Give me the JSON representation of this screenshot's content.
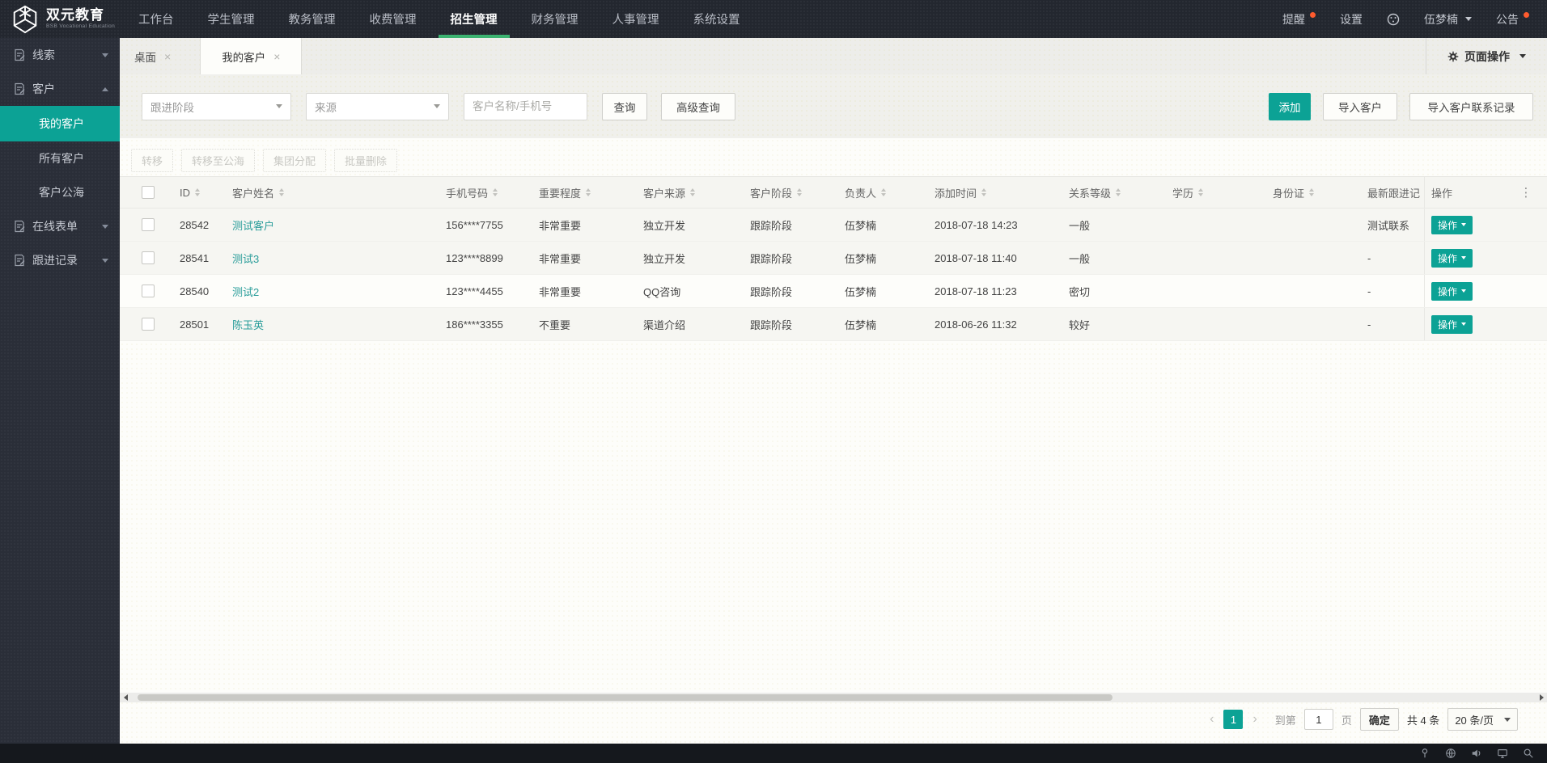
{
  "navbar": {
    "logo_title": "双元教育",
    "logo_subtitle": "BSB Vocational Education",
    "menu": [
      "工作台",
      "学生管理",
      "教务管理",
      "收费管理",
      "招生管理",
      "财务管理",
      "人事管理",
      "系统设置"
    ],
    "right": {
      "reminder": "提醒",
      "settings": "设置",
      "user": "伍梦楠",
      "announcement": "公告"
    }
  },
  "sidebar": {
    "leads": "线索",
    "customers": "客户",
    "my_customers": "我的客户",
    "all_customers": "所有客户",
    "customer_pool": "客户公海",
    "online_forms": "在线表单",
    "follow_records": "跟进记录"
  },
  "tabs": {
    "desktop": "桌面",
    "my_customers": "我的客户",
    "page_actions": "页面操作"
  },
  "filters": {
    "stage_placeholder": "跟进阶段",
    "source_placeholder": "来源",
    "keyword_placeholder": "客户名称/手机号",
    "search": "查询",
    "advanced": "高级查询",
    "add": "添加",
    "import_customers": "导入客户",
    "import_records": "导入客户联系记录"
  },
  "bulk": {
    "transfer": "转移",
    "transfer_pool": "转移至公海",
    "group_assign": "集团分配",
    "batch_delete": "批量删除"
  },
  "table": {
    "headers": [
      "ID",
      "客户姓名",
      "手机号码",
      "重要程度",
      "客户来源",
      "客户阶段",
      "负责人",
      "添加时间",
      "关系等级",
      "学历",
      "身份证",
      "最新跟进记",
      "操作"
    ],
    "action_label": "操作",
    "rows": [
      {
        "id": "28542",
        "name": "测试客户",
        "phone": "156****7755",
        "importance": "非常重要",
        "source": "独立开发",
        "stage": "跟踪阶段",
        "owner": "伍梦楠",
        "added": "2018-07-18 14:23",
        "relation": "一般",
        "education": "",
        "id_card": "",
        "latest": "测试联系"
      },
      {
        "id": "28541",
        "name": "测试3",
        "phone": "123****8899",
        "importance": "非常重要",
        "source": "独立开发",
        "stage": "跟踪阶段",
        "owner": "伍梦楠",
        "added": "2018-07-18 11:40",
        "relation": "一般",
        "education": "",
        "id_card": "",
        "latest": "-"
      },
      {
        "id": "28540",
        "name": "测试2",
        "phone": "123****4455",
        "importance": "非常重要",
        "source": "QQ咨询",
        "stage": "跟踪阶段",
        "owner": "伍梦楠",
        "added": "2018-07-18 11:23",
        "relation": "密切",
        "education": "",
        "id_card": "",
        "latest": "-"
      },
      {
        "id": "28501",
        "name": "陈玉英",
        "phone": "186****3355",
        "importance": "不重要",
        "source": "渠道介绍",
        "stage": "跟踪阶段",
        "owner": "伍梦楠",
        "added": "2018-06-26 11:32",
        "relation": "较好",
        "education": "",
        "id_card": "",
        "latest": "-"
      }
    ]
  },
  "pagination": {
    "page_current": "1",
    "goto_label": "到第",
    "page_input": "1",
    "page_unit": "页",
    "confirm_label": "确定",
    "total_label": "共 4 条",
    "page_size": "20 条/页"
  },
  "icons": {
    "close": "×",
    "dots_vertical": "⋮",
    "chevron_prev": "‹",
    "chevron_next": "›"
  },
  "colors": {
    "accent_teal": "#0ca295",
    "nav_active_underline": "#3cb371",
    "notification_dot": "#ff5b2e",
    "link": "#2a9d9a"
  }
}
